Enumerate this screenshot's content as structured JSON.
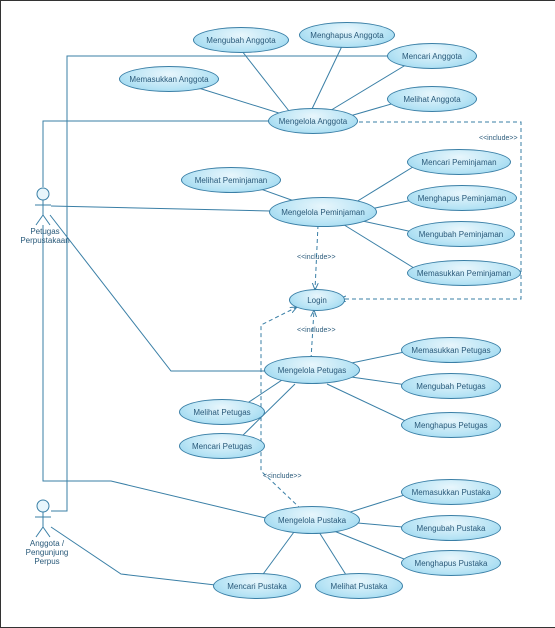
{
  "actors": {
    "petugas": "Petugas Perpustakaan",
    "anggota": "Anggota / Pengunjung\nPerpus"
  },
  "usecases": {
    "memasukkan_anggota": "Memasukkan Anggota",
    "mengubah_anggota": "Mengubah Anggota",
    "menghapus_anggota": "Menghapus Anggota",
    "mencari_anggota": "Mencari Anggota",
    "melihat_anggota": "Melihat Anggota",
    "mengelola_anggota": "Mengelola Anggota",
    "melihat_peminjaman": "Melihat Peminjaman",
    "mengelola_peminjaman": "Mengelola Peminjaman",
    "mencari_peminjaman": "Mencari Peminjaman",
    "menghapus_peminjaman": "Menghapus Peminjaman",
    "mengubah_peminjaman": "Mengubah Peminjaman",
    "memasukkan_peminjaman": "Memasukkan Peminjaman",
    "login": "Login",
    "mengelola_petugas": "Mengelola Petugas",
    "memasukkan_petugas": "Memasukkan Petugas",
    "mengubah_petugas": "Mengubah Petugas",
    "menghapus_petugas": "Menghapus Petugas",
    "melihat_petugas": "Melihat Petugas",
    "mencari_petugas": "Mencari Petugas",
    "mengelola_pustaka": "Mengelola Pustaka",
    "memasukkan_pustaka": "Memasukkan Pustaka",
    "mengubah_pustaka": "Mengubah Pustaka",
    "menghapus_pustaka": "Menghapus Pustaka",
    "mencari_pustaka": "Mencari Pustaka",
    "melihat_pustaka": "Melihat Pustaka"
  },
  "labels": {
    "include1": "<<include>>",
    "include2": "<<include>>",
    "include3": "<<include>>",
    "include4": "<<include>>"
  },
  "chart_data": {
    "type": "uml-use-case-diagram",
    "actors": [
      {
        "id": "petugas",
        "name": "Petugas Perpustakaan"
      },
      {
        "id": "anggota",
        "name": "Anggota / Pengunjung Perpus"
      }
    ],
    "use_cases": [
      {
        "id": "login",
        "name": "Login"
      },
      {
        "id": "mengelola_anggota",
        "name": "Mengelola Anggota",
        "extends": [
          "memasukkan_anggota",
          "mengubah_anggota",
          "menghapus_anggota",
          "mencari_anggota",
          "melihat_anggota"
        ],
        "includes": [
          "login"
        ]
      },
      {
        "id": "memasukkan_anggota",
        "name": "Memasukkan Anggota"
      },
      {
        "id": "mengubah_anggota",
        "name": "Mengubah Anggota"
      },
      {
        "id": "menghapus_anggota",
        "name": "Menghapus Anggota"
      },
      {
        "id": "mencari_anggota",
        "name": "Mencari Anggota"
      },
      {
        "id": "melihat_anggota",
        "name": "Melihat Anggota"
      },
      {
        "id": "mengelola_peminjaman",
        "name": "Mengelola Peminjaman",
        "extends": [
          "melihat_peminjaman",
          "mencari_peminjaman",
          "menghapus_peminjaman",
          "mengubah_peminjaman",
          "memasukkan_peminjaman"
        ],
        "includes": [
          "login"
        ]
      },
      {
        "id": "melihat_peminjaman",
        "name": "Melihat Peminjaman"
      },
      {
        "id": "mencari_peminjaman",
        "name": "Mencari Peminjaman"
      },
      {
        "id": "menghapus_peminjaman",
        "name": "Menghapus Peminjaman"
      },
      {
        "id": "mengubah_peminjaman",
        "name": "Mengubah Peminjaman"
      },
      {
        "id": "memasukkan_peminjaman",
        "name": "Memasukkan Peminjaman"
      },
      {
        "id": "mengelola_petugas",
        "name": "Mengelola Petugas",
        "extends": [
          "memasukkan_petugas",
          "mengubah_petugas",
          "menghapus_petugas",
          "melihat_petugas",
          "mencari_petugas"
        ],
        "includes": [
          "login"
        ]
      },
      {
        "id": "memasukkan_petugas",
        "name": "Memasukkan Petugas"
      },
      {
        "id": "mengubah_petugas",
        "name": "Mengubah Petugas"
      },
      {
        "id": "menghapus_petugas",
        "name": "Menghapus Petugas"
      },
      {
        "id": "melihat_petugas",
        "name": "Melihat Petugas"
      },
      {
        "id": "mencari_petugas",
        "name": "Mencari Petugas"
      },
      {
        "id": "mengelola_pustaka",
        "name": "Mengelola Pustaka",
        "extends": [
          "memasukkan_pustaka",
          "mengubah_pustaka",
          "menghapus_pustaka",
          "mencari_pustaka",
          "melihat_pustaka"
        ],
        "includes": [
          "login"
        ]
      },
      {
        "id": "memasukkan_pustaka",
        "name": "Memasukkan Pustaka"
      },
      {
        "id": "mengubah_pustaka",
        "name": "Mengubah Pustaka"
      },
      {
        "id": "menghapus_pustaka",
        "name": "Menghapus Pustaka"
      },
      {
        "id": "mencari_pustaka",
        "name": "Mencari Pustaka"
      },
      {
        "id": "melihat_pustaka",
        "name": "Melihat Pustaka"
      }
    ],
    "associations": [
      {
        "actor": "petugas",
        "use_case": "mengelola_anggota"
      },
      {
        "actor": "petugas",
        "use_case": "mengelola_peminjaman"
      },
      {
        "actor": "petugas",
        "use_case": "mengelola_petugas"
      },
      {
        "actor": "petugas",
        "use_case": "mengelola_pustaka"
      },
      {
        "actor": "anggota",
        "use_case": "mencari_anggota"
      },
      {
        "actor": "anggota",
        "use_case": "mencari_pustaka"
      }
    ]
  }
}
